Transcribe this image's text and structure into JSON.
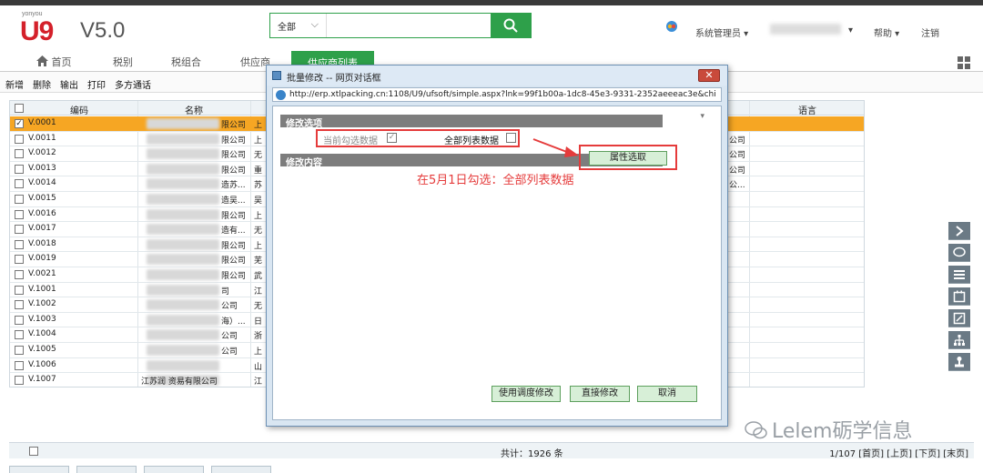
{
  "app": {
    "brand_small": "yonyou",
    "brand_u9": "U9",
    "brand_version": "V5.0"
  },
  "search": {
    "scope": "全部",
    "value": ""
  },
  "header_right": {
    "user": "系统管理员",
    "help": "帮助",
    "logout": "注销"
  },
  "nav": {
    "tabs": [
      {
        "label": "首页"
      },
      {
        "label": "税别"
      },
      {
        "label": "税组合"
      },
      {
        "label": "供应商"
      },
      {
        "label": "供应商列表"
      }
    ]
  },
  "toolbar": {
    "items": [
      "新增",
      "删除",
      "输出",
      "打印",
      "多方通话"
    ]
  },
  "table": {
    "headers": {
      "code": "编码",
      "name": "名称",
      "language": "语言"
    },
    "rows": [
      {
        "code": "V.0001",
        "name_tail": "限公司",
        "col3": "上",
        "extra": "",
        "selected": true
      },
      {
        "code": "V.0011",
        "name_tail": "限公司",
        "col3": "上",
        "extra": "公司",
        "selected": false
      },
      {
        "code": "V.0012",
        "name_tail": "限公司",
        "col3": "无",
        "extra": "公司",
        "selected": false
      },
      {
        "code": "V.0013",
        "name_tail": "限公司",
        "col3": "重",
        "extra": "公司",
        "selected": false
      },
      {
        "code": "V.0014",
        "name_tail": "造苏...",
        "col3": "苏",
        "extra": "公...",
        "selected": false
      },
      {
        "code": "V.0015",
        "name_tail": "造吴...",
        "col3": "吴",
        "extra": "",
        "selected": false
      },
      {
        "code": "V.0016",
        "name_tail": "限公司",
        "col3": "上",
        "extra": "",
        "selected": false
      },
      {
        "code": "V.0017",
        "name_tail": "造有...",
        "col3": "无",
        "extra": "",
        "selected": false
      },
      {
        "code": "V.0018",
        "name_tail": "限公司",
        "col3": "上",
        "extra": "",
        "selected": false
      },
      {
        "code": "V.0019",
        "name_tail": "限公司",
        "col3": "芜",
        "extra": "",
        "selected": false
      },
      {
        "code": "V.0021",
        "name_tail": "限公司",
        "col3": "武",
        "extra": "",
        "selected": false
      },
      {
        "code": "V.1001",
        "name_tail": "司",
        "col3": "江",
        "extra": "",
        "selected": false
      },
      {
        "code": "V.1002",
        "name_tail": "公司",
        "col3": "无",
        "extra": "",
        "selected": false
      },
      {
        "code": "V.1003",
        "name_tail": "海）...",
        "col3": "日",
        "extra": "",
        "selected": false
      },
      {
        "code": "V.1004",
        "name_tail": "公司",
        "col3": "浙",
        "extra": "",
        "selected": false
      },
      {
        "code": "V.1005",
        "name_tail": "公司",
        "col3": "上",
        "extra": "",
        "selected": false
      },
      {
        "code": "V.1006",
        "name_tail": "",
        "col3": "山",
        "extra": "",
        "selected": false
      },
      {
        "code": "V.1007",
        "name_tail": "江苏润 资易有限公司",
        "col3": "江",
        "extra": "",
        "selected": false
      }
    ]
  },
  "footer": {
    "total": "共计：1926 条",
    "pager": "1/107 [首页] [上页] [下页] [末页]"
  },
  "dialog": {
    "title": "批量修改 -- 网页对话框",
    "close_label": "✕",
    "url": "http://erp.xtlpacking.cn:1108/U9/ufsoft/simple.aspx?lnk=99f1b00a-1dc8-45e3-9331-2352aeeeac3e&chi",
    "section_options": "修改选项",
    "section_content": "修改内容",
    "opt_current": "当前勾选数据",
    "opt_current_check": "✓",
    "opt_all": "全部列表数据",
    "attr_button": "属性选取",
    "annotation": "在5月1日勾选：全部列表数据",
    "btn_batch": "使用调度修改",
    "btn_direct": "直接修改",
    "btn_cancel": "取消"
  },
  "watermark": "Lelem砺学信息",
  "colors": {
    "accent": "#2ea04a",
    "selected_row": "#f6a623",
    "annotation": "#e53b3b",
    "brand_red": "#d4202a"
  }
}
